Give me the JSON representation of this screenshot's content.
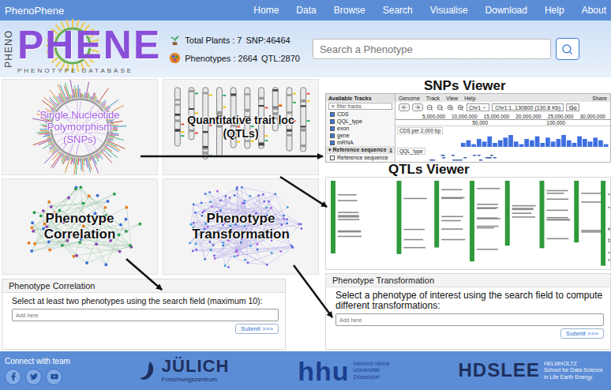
{
  "navbar": {
    "brand": "PhenoPhene",
    "items": [
      {
        "label": "Home"
      },
      {
        "label": "Data"
      },
      {
        "label": "Browse"
      },
      {
        "label": "Search"
      },
      {
        "label": "Visualise"
      },
      {
        "label": "Download"
      },
      {
        "label": "Help"
      },
      {
        "label": "About"
      }
    ]
  },
  "logo": {
    "side": "PHENO",
    "word": "PHENE",
    "subtitle": "PHENOTYPE DATABASE"
  },
  "stats": [
    {
      "kind": "plants",
      "label": "Total Plants : 7",
      "count": "SNP:46464"
    },
    {
      "kind": "phenotypes",
      "label": "Phenotypes : 2664",
      "count": "QTL:2870"
    }
  ],
  "search": {
    "placeholder": "Search a Phenotype"
  },
  "cards": [
    {
      "kind": "circos",
      "lines": [
        "Single Nucleotide",
        "Polymorphism",
        "(SNPs)"
      ],
      "color": "#a45ee5"
    },
    {
      "kind": "ideogram",
      "lines": [
        "Quantitative trait loc",
        "(QTLs)"
      ],
      "color": "#111111"
    },
    {
      "kind": "correlation",
      "lines": [
        "Phenotype",
        "Correlation"
      ],
      "color": "#111111"
    },
    {
      "kind": "transformation",
      "lines": [
        "Phenotype",
        "Transformation"
      ],
      "color": "#111111"
    }
  ],
  "snps_viewer": {
    "title": "SNPs Viewer",
    "tracks_title": "Available Tracks",
    "filter_icon": "✕",
    "filter": "filter tracks",
    "tracks": [
      {
        "label": "CDS",
        "checked": true
      },
      {
        "label": "QQL_type",
        "checked": true
      },
      {
        "label": "exon",
        "checked": true
      },
      {
        "label": "gene",
        "checked": true
      },
      {
        "label": "mRNA",
        "checked": true
      }
    ],
    "reference": {
      "toggle": "▾",
      "label": "Reference sequence",
      "count": "1",
      "item": {
        "label": "Reference sequence",
        "checked": false
      }
    },
    "menu": [
      "Genome",
      "Track",
      "View",
      "Help"
    ],
    "share": "Share",
    "chromosome": "Chr1",
    "location": "Chr1:1..130800 (130.8 Kb)",
    "go": "Go",
    "ticks": [
      "5,000,000",
      "10,000,000",
      "15,000,000",
      "20,000,000",
      "25,000,000",
      "30,000,000"
    ],
    "detail_ticks": [
      "50,000",
      "100,000"
    ],
    "histogram": {
      "label": "CDS per 2,000 bp",
      "values": [
        0,
        0,
        0,
        0,
        0,
        0,
        0,
        0,
        0,
        0,
        0,
        0,
        3,
        5,
        2,
        6,
        4,
        8,
        3,
        5,
        7,
        9,
        4,
        2,
        6,
        5,
        8,
        3,
        7,
        4,
        6,
        9,
        5,
        3,
        8,
        6,
        4,
        7,
        5,
        2
      ]
    },
    "feature_track": "QQL_type"
  },
  "qtls_viewer": {
    "title": "QTLs Viewer"
  },
  "correlation": {
    "title": "Phenotype Correlation",
    "prompt": "Select at least two phenotypes using the search field (maximum 10):",
    "placeholder": "Add here",
    "submit": "Submit >>>"
  },
  "transformation": {
    "title": "Phenotype Transformation",
    "prompt": "Select a phenotype of interest using the search field to compute different transformations:",
    "placeholder": "Add here",
    "submit": "Submit >>>"
  },
  "footer": {
    "connect": "Connect with team",
    "social": [
      {
        "kind": "facebook"
      },
      {
        "kind": "twitter"
      },
      {
        "kind": "youtube"
      }
    ],
    "partners": [
      {
        "kind": "julich",
        "name": "JÜLICH",
        "lines": [
          "Forschungszentrum"
        ]
      },
      {
        "kind": "hhu",
        "name": "hhu",
        "lines": [
          "Heinrich Heine",
          "Universität",
          "Düsseldorf"
        ]
      },
      {
        "kind": "hdslee",
        "name": "HDSLEE",
        "lines": [
          "HELMHOLTZ",
          "School for Data Science",
          "in Life Earth Energy"
        ]
      }
    ]
  }
}
